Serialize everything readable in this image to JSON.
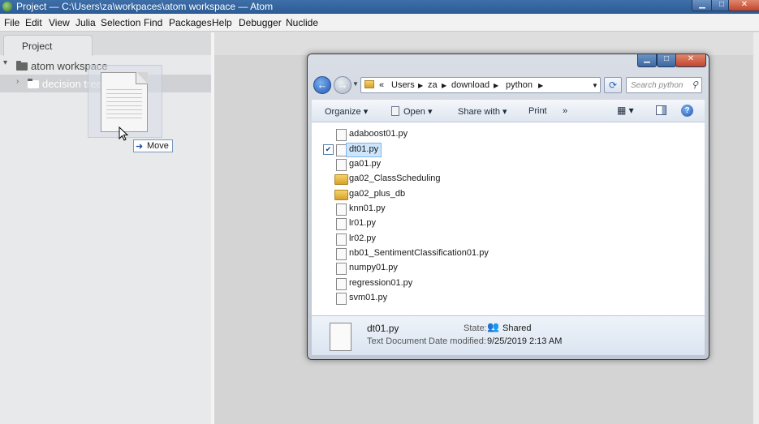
{
  "atom": {
    "title": "Project — C:\\Users\\za\\workpaces\\atom workspace — Atom",
    "window_controls": {
      "minimize": "▁",
      "maximize": "□",
      "close": "✕"
    },
    "menu": [
      "File",
      "Edit",
      "View",
      "Julia",
      "Selection",
      "Find",
      "Packages",
      "Help",
      "Debugger",
      "Nuclide"
    ],
    "tab": "Project",
    "tree": {
      "root": "atom workspace",
      "child": "decision trees"
    },
    "drag_tooltip": {
      "icon": "move-arrow-icon",
      "label": "Move"
    }
  },
  "explorer": {
    "controls": {
      "minimize": "▁",
      "maximize": "□",
      "close": "✕"
    },
    "nav": {
      "back": "back-arrow-icon",
      "forward": "forward-arrow-icon"
    },
    "breadcrumbs": [
      "«",
      "Users",
      "za",
      "download",
      "python"
    ],
    "search_placeholder": "Search python",
    "toolbar": {
      "organize": "Organize ▾",
      "open": "Open ▾",
      "share_with": "Share with ▾",
      "print": "Print",
      "more": "»"
    },
    "files": [
      {
        "name": "adaboost01.py",
        "type": "file"
      },
      {
        "name": "dt01.py",
        "type": "file",
        "selected": true
      },
      {
        "name": "ga01.py",
        "type": "file"
      },
      {
        "name": "ga02_ClassScheduling",
        "type": "folder"
      },
      {
        "name": "ga02_plus_db",
        "type": "folder"
      },
      {
        "name": "knn01.py",
        "type": "file"
      },
      {
        "name": "lr01.py",
        "type": "file"
      },
      {
        "name": "lr02.py",
        "type": "file"
      },
      {
        "name": "nb01_SentimentClassification01.py",
        "type": "file"
      },
      {
        "name": "numpy01.py",
        "type": "file"
      },
      {
        "name": "regression01.py",
        "type": "file"
      },
      {
        "name": "svm01.py",
        "type": "file"
      }
    ],
    "details": {
      "filename": "dt01.py",
      "filetype": "Text Document",
      "state_label": "State:",
      "state_value": "Shared",
      "modified_label": "Date modified:",
      "modified_value": "9/25/2019 2:13 AM"
    }
  }
}
